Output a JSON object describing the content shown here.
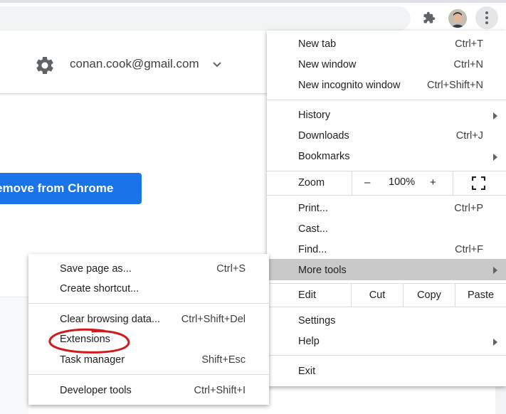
{
  "account": {
    "email": "conan.cook@gmail.com"
  },
  "page": {
    "remove_button_label": "emove from Chrome"
  },
  "colors": {
    "accent": "#1a73e8",
    "highlight_row": "#c9c9c9",
    "annotation": "#d11a1a"
  },
  "icons": {
    "extensions": "puzzle-icon",
    "settings": "gear-icon",
    "menu": "three-dot-menu-icon",
    "fullscreen": "fullscreen-icon",
    "account_dropdown": "chevron-down-icon"
  },
  "menu": {
    "group1": [
      {
        "label": "New tab",
        "shortcut": "Ctrl+T"
      },
      {
        "label": "New window",
        "shortcut": "Ctrl+N"
      },
      {
        "label": "New incognito window",
        "shortcut": "Ctrl+Shift+N"
      }
    ],
    "group2": [
      {
        "label": "History",
        "shortcut": ""
      },
      {
        "label": "Downloads",
        "shortcut": "Ctrl+J"
      },
      {
        "label": "Bookmarks",
        "shortcut": ""
      }
    ],
    "zoom": {
      "label": "Zoom",
      "minus": "–",
      "value": "100%",
      "plus": "+"
    },
    "group3": [
      {
        "label": "Print...",
        "shortcut": "Ctrl+P"
      },
      {
        "label": "Cast...",
        "shortcut": ""
      },
      {
        "label": "Find...",
        "shortcut": "Ctrl+F"
      },
      {
        "label": "More tools",
        "shortcut": ""
      }
    ],
    "edit": {
      "label": "Edit",
      "cut": "Cut",
      "copy": "Copy",
      "paste": "Paste"
    },
    "group4": [
      {
        "label": "Settings",
        "shortcut": ""
      },
      {
        "label": "Help",
        "shortcut": ""
      }
    ],
    "exit": {
      "label": "Exit"
    }
  },
  "submenu": {
    "group1": [
      {
        "label": "Save page as...",
        "shortcut": "Ctrl+S"
      },
      {
        "label": "Create shortcut...",
        "shortcut": ""
      }
    ],
    "group2": [
      {
        "label": "Clear browsing data...",
        "shortcut": "Ctrl+Shift+Del"
      },
      {
        "label": "Extensions",
        "shortcut": ""
      },
      {
        "label": "Task manager",
        "shortcut": "Shift+Esc"
      }
    ],
    "group3": [
      {
        "label": "Developer tools",
        "shortcut": "Ctrl+Shift+I"
      }
    ]
  }
}
